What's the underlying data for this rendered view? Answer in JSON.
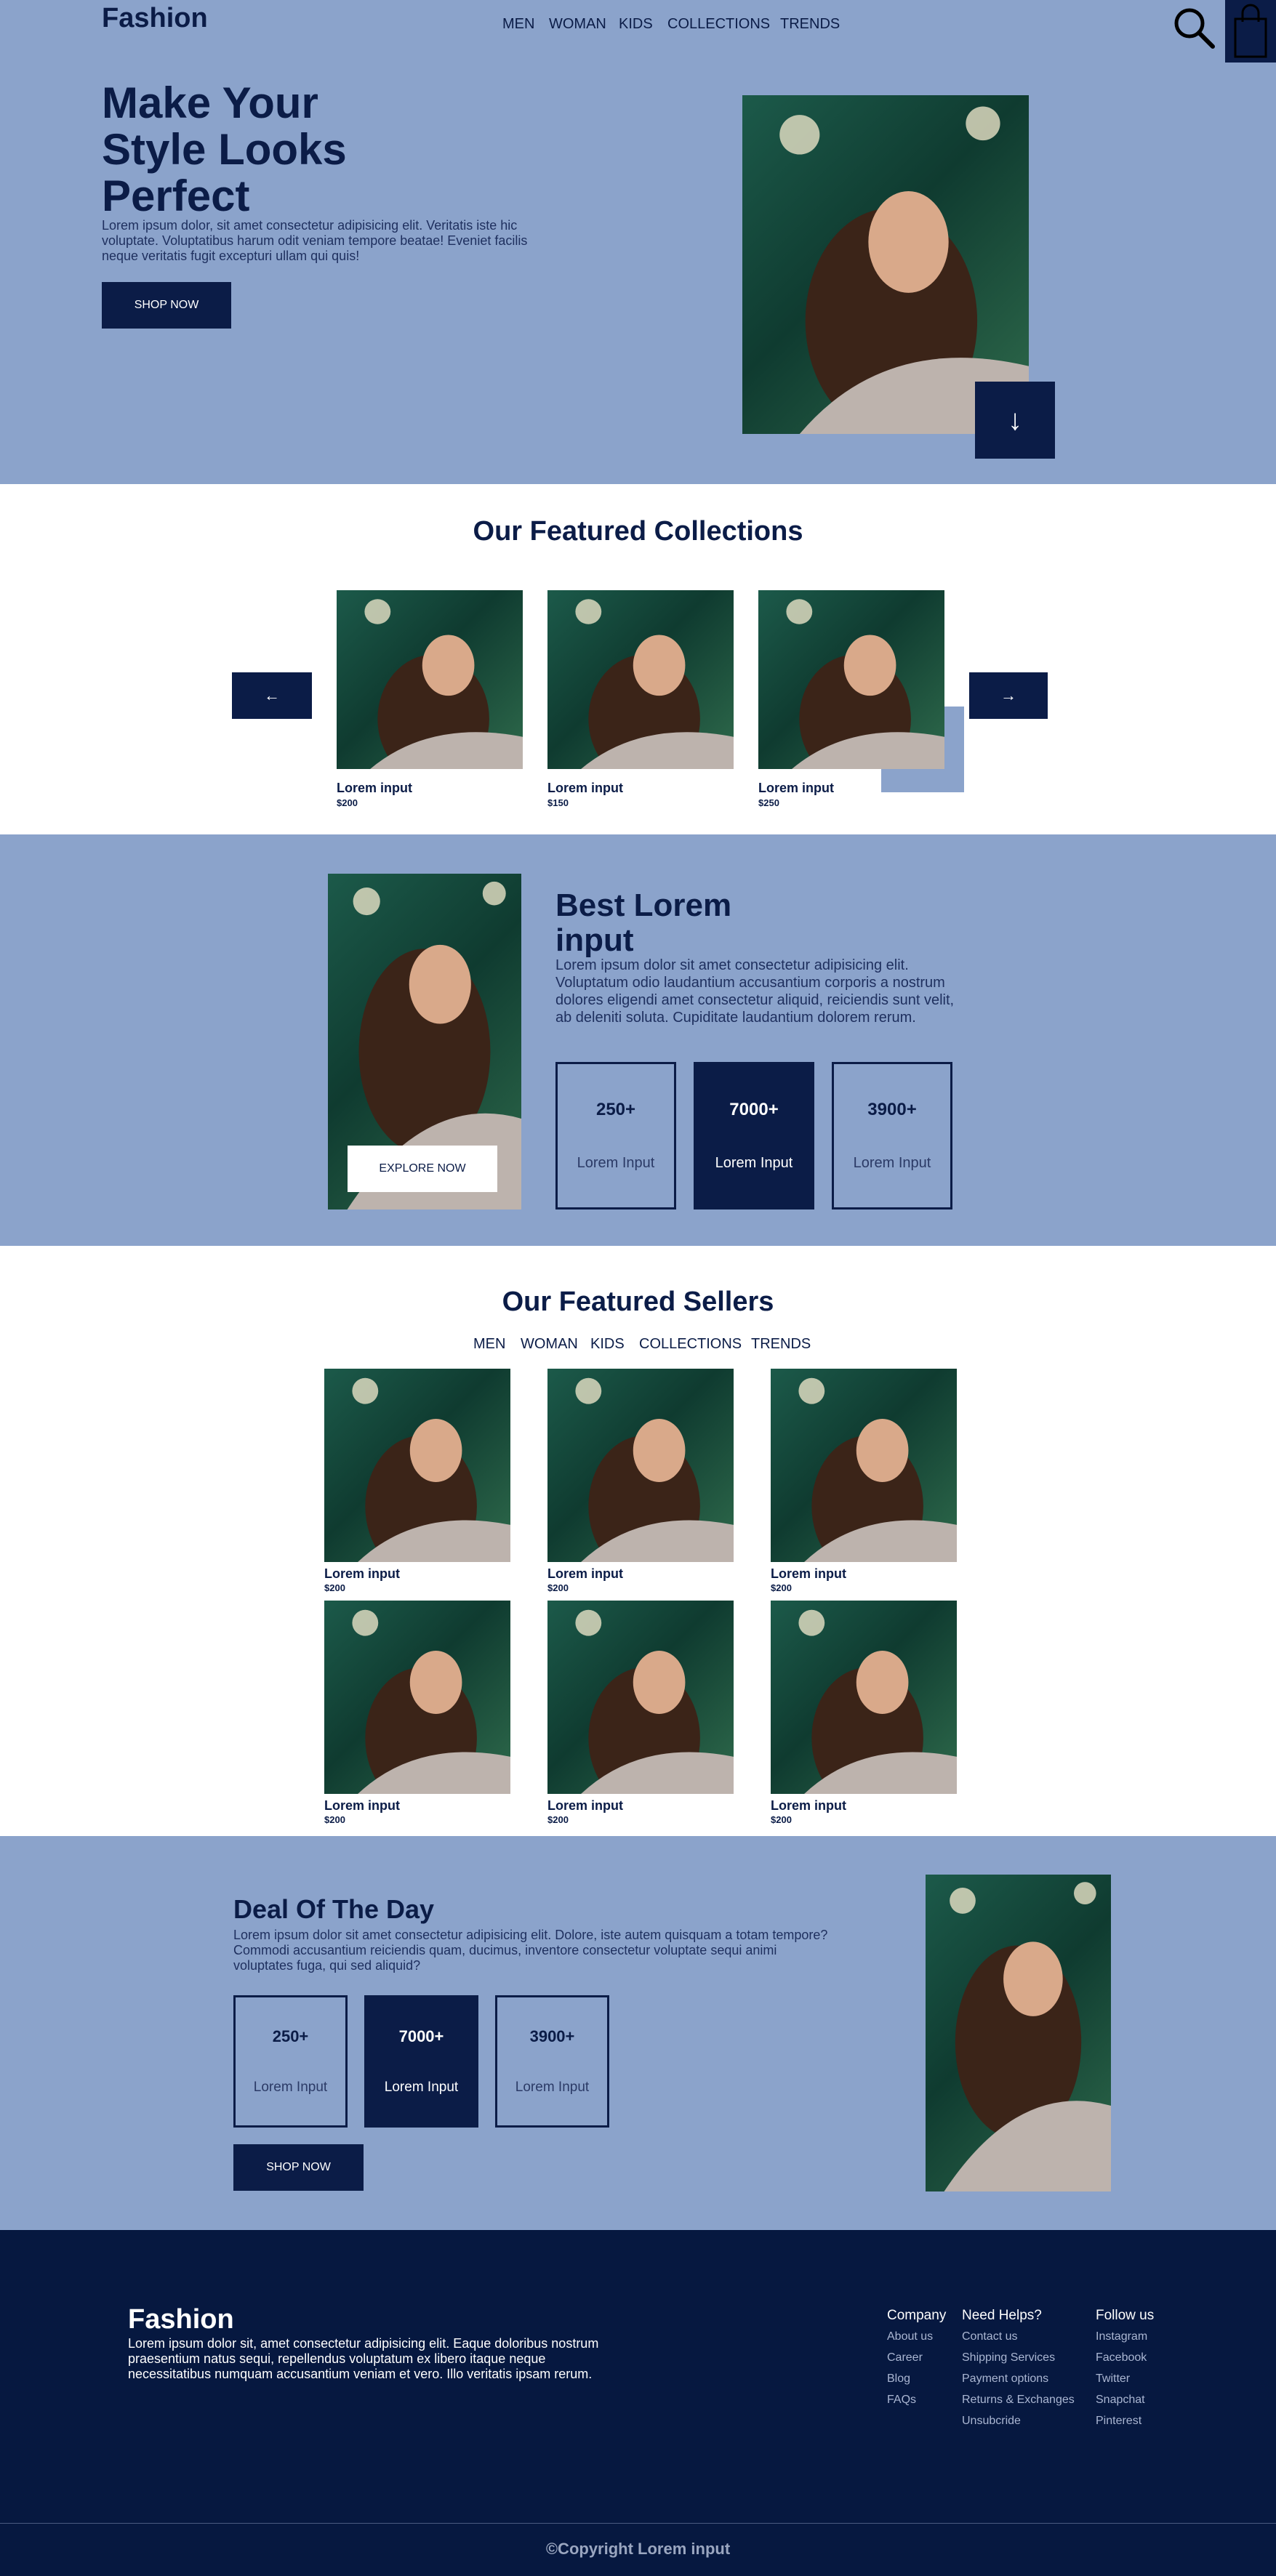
{
  "header": {
    "logo": "Fashion",
    "nav": [
      "MEN",
      "WOMAN",
      "KIDS",
      "COLLECTIONS",
      "TRENDS"
    ]
  },
  "hero": {
    "title_lines": [
      "Make Your",
      "Style Looks",
      "Perfect"
    ],
    "text": "Lorem ipsum dolor, sit amet consectetur adipisicing elit. Veritatis iste hic voluptate. Voluptatibus harum odit veniam tempore beatae! Eveniet facilis neque veritatis fugit excepturi ullam qui quis!",
    "button": "SHOP NOW",
    "scroll_arrow": "↓"
  },
  "collections": {
    "title": "Our Featured Collections",
    "prev": "←",
    "next": "→",
    "items": [
      {
        "name": "Lorem input",
        "price": "$200"
      },
      {
        "name": "Lorem input",
        "price": "$150"
      },
      {
        "name": "Lorem input",
        "price": "$250"
      }
    ]
  },
  "best": {
    "title_lines": [
      "Best Lorem",
      "input"
    ],
    "text": "Lorem ipsum dolor sit amet consectetur adipisicing elit. Voluptatum odio laudantium accusantium corporis a nostrum dolores eligendi amet consectetur aliquid, reiciendis sunt velit, ab deleniti soluta. Cupiditate laudantium dolorem rerum.",
    "button": "EXPLORE NOW",
    "stats": [
      {
        "value": "250+",
        "label": "Lorem Input"
      },
      {
        "value": "7000+",
        "label": "Lorem Input"
      },
      {
        "value": "3900+",
        "label": "Lorem Input"
      }
    ]
  },
  "sellers": {
    "title": "Our Featured Sellers",
    "tabs": [
      "MEN",
      "WOMAN",
      "KIDS",
      "COLLECTIONS",
      "TRENDS"
    ],
    "items": [
      {
        "name": "Lorem input",
        "price": "$200"
      },
      {
        "name": "Lorem input",
        "price": "$200"
      },
      {
        "name": "Lorem input",
        "price": "$200"
      },
      {
        "name": "Lorem input",
        "price": "$200"
      },
      {
        "name": "Lorem input",
        "price": "$200"
      },
      {
        "name": "Lorem input",
        "price": "$200"
      }
    ]
  },
  "deal": {
    "title": "Deal Of The Day",
    "text": "Lorem ipsum dolor sit amet consectetur adipisicing elit. Dolore, iste autem quisquam a totam tempore? Commodi accusantium reiciendis quam, ducimus, inventore consectetur voluptate sequi animi voluptates fuga, qui sed aliquid?",
    "button": "SHOP NOW",
    "stats": [
      {
        "value": "250+",
        "label": "Lorem Input"
      },
      {
        "value": "7000+",
        "label": "Lorem Input"
      },
      {
        "value": "3900+",
        "label": "Lorem Input"
      }
    ]
  },
  "footer": {
    "logo": "Fashion",
    "text": "Lorem ipsum dolor sit, amet consectetur adipisicing elit. Eaque doloribus nostrum praesentium natus sequi, repellendus voluptatum ex libero itaque neque necessitatibus numquam accusantium veniam et vero. Illo veritatis ipsam rerum.",
    "columns": [
      {
        "heading": "Company",
        "links": [
          "About us",
          "Career",
          "Blog",
          "FAQs"
        ]
      },
      {
        "heading": "Need Helps?",
        "links": [
          "Contact us",
          "Shipping Services",
          "Payment options",
          "Returns & Exchanges",
          "Unsubcride"
        ]
      },
      {
        "heading": "Follow us",
        "links": [
          "Instagram",
          "Facebook",
          "Twitter",
          "Snapchat",
          "Pinterest"
        ]
      }
    ],
    "copyright": "©Copyright Lorem input"
  },
  "colors": {
    "band_blue": "#8ba3cb",
    "navy": "#0b1c47",
    "footer_navy": "#061840",
    "white": "#ffffff"
  },
  "icons": [
    "search-icon",
    "shopping-bag-icon",
    "arrow-down-icon",
    "arrow-left-icon",
    "arrow-right-icon"
  ]
}
